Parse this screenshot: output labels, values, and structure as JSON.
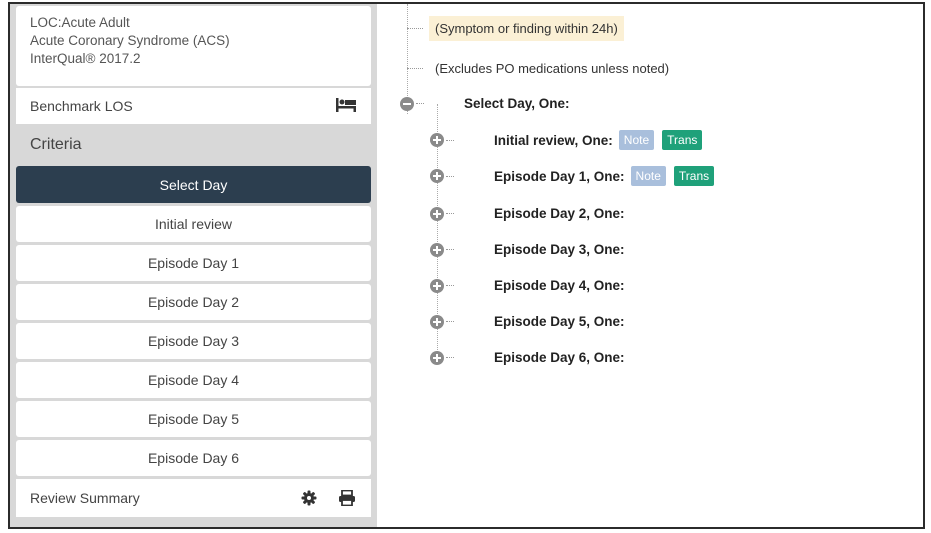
{
  "header": {
    "loc": "LOC:Acute Adult",
    "subset": "Acute Coronary Syndrome (ACS)",
    "version": "InterQual® 2017.2"
  },
  "benchmark": {
    "label": "Benchmark LOS",
    "icon": "bed-icon"
  },
  "criteria": {
    "heading": "Criteria",
    "items": [
      {
        "label": "Select Day",
        "active": true
      },
      {
        "label": "Initial review"
      },
      {
        "label": "Episode Day 1"
      },
      {
        "label": "Episode Day 2"
      },
      {
        "label": "Episode Day 3"
      },
      {
        "label": "Episode Day 4"
      },
      {
        "label": "Episode Day 5"
      },
      {
        "label": "Episode Day 6"
      }
    ]
  },
  "summary": {
    "label": "Review Summary",
    "icons": [
      "gear-icon",
      "print-icon"
    ]
  },
  "tree": {
    "note1": "(Symptom or finding within 24h)",
    "note2": "(Excludes PO medications unless noted)",
    "root": "Select Day, One:",
    "children": [
      {
        "label": "Initial review, One:",
        "note": "Note",
        "trans": "Trans"
      },
      {
        "label": "Episode Day 1, One:",
        "note": "Note",
        "trans": "Trans"
      },
      {
        "label": "Episode Day 2, One:"
      },
      {
        "label": "Episode Day 3, One:"
      },
      {
        "label": "Episode Day 4, One:"
      },
      {
        "label": "Episode Day 5, One:"
      },
      {
        "label": "Episode Day 6, One:"
      }
    ]
  },
  "colors": {
    "active_nav": "#2c3e4f",
    "note_badge": "#a9bfdc",
    "trans_badge": "#1fa17a",
    "highlight": "#fbf0d5"
  }
}
